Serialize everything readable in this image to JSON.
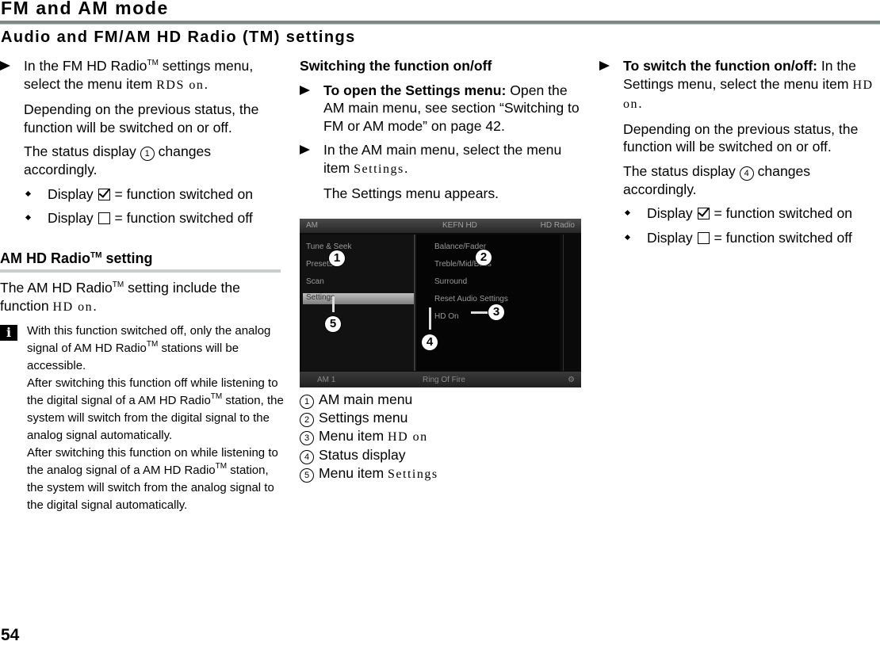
{
  "chapter_title": "FM and AM mode",
  "section_title": "Audio and FM/AM HD Radio (TM) settings",
  "column1": {
    "step1_pre": "In the FM HD Radio",
    "step1_tm": "TM",
    "step1_post": " settings menu, select the menu item ",
    "step1_item": "RDS on",
    "step1_end": ".",
    "para1": "Depending on the previous status, the function will be switched on or off.",
    "para2_pre": "The status display ",
    "para2_callout": "1",
    "para2_post": " changes accordingly.",
    "bullet_on_pre": "Display ",
    "bullet_on_post": " = function switched on",
    "bullet_off_pre": "Display ",
    "bullet_off_post": " = function switched off",
    "subheading_pre": "AM HD Radio",
    "subheading_tm": "TM",
    "subheading_post": " setting",
    "intro_pre": "The AM HD Radio",
    "intro_tm": "TM",
    "intro_mid": " setting include the function ",
    "intro_item": "HD on",
    "intro_end": ".",
    "note_icon": "i",
    "note_l1": "With this function switched off, only the analog signal of AM HD Radio",
    "note_l1_tm": "TM",
    "note_l1_end": " stations will be accessible.",
    "note_l2": "After switching this function off while listening to the digital signal of a AM HD Radio",
    "note_l2_tm": "TM",
    "note_l2_end": " station, the system will switch from the digital signal to the analog signal automatically.",
    "note_l3": "After switching this function on while listening to the analog signal of a AM HD Radio",
    "note_l3_tm": "TM",
    "note_l3_end": " station, the system will switch from the analog signal to the digital signal automatically."
  },
  "column2": {
    "heading": "Switching the function on/off",
    "step1_bold": "To open the Settings menu:",
    "step1_text": " Open the AM main menu, see section “Switching to FM or AM mode” on page 42.",
    "step2_text": "In the AM main menu, select the menu item ",
    "step2_item": "Settings",
    "step2_end": ".",
    "para": "The Settings menu appears.",
    "screen": {
      "top_left": "AM",
      "top_mid": "KEFN HD",
      "top_right": "HD Radio",
      "left_menu": [
        "Tune & Seek",
        "Presets",
        "Scan",
        "Settings"
      ],
      "right_menu": [
        "Balance/Fader",
        "Treble/Mid/Bass",
        "Surround",
        "Reset Audio Settings",
        "HD On"
      ],
      "bottom_left": "AM 1",
      "bottom_mid": "Ring Of Fire",
      "callouts": [
        "1",
        "2",
        "3",
        "4",
        "5"
      ]
    },
    "legend": [
      {
        "num": "1",
        "text": "AM main menu",
        "item": ""
      },
      {
        "num": "2",
        "text": "Settings menu",
        "item": ""
      },
      {
        "num": "3",
        "text": "Menu item ",
        "item": "HD on"
      },
      {
        "num": "4",
        "text": "Status display",
        "item": ""
      },
      {
        "num": "5",
        "text": "Menu item ",
        "item": "Settings"
      }
    ]
  },
  "column3": {
    "step_bold": "To switch the function on/off:",
    "step_text": " In the Settings menu, select the menu item ",
    "step_item": "HD on",
    "step_end": ".",
    "para1": "Depending on the previous status, the function will be switched on or off.",
    "para2_pre": "The status display ",
    "para2_callout": "4",
    "para2_post": " changes accordingly.",
    "bullet_on_pre": "Display ",
    "bullet_on_post": " = function switched on",
    "bullet_off_pre": "Display ",
    "bullet_off_post": " = function switched off"
  },
  "page_number": "54"
}
